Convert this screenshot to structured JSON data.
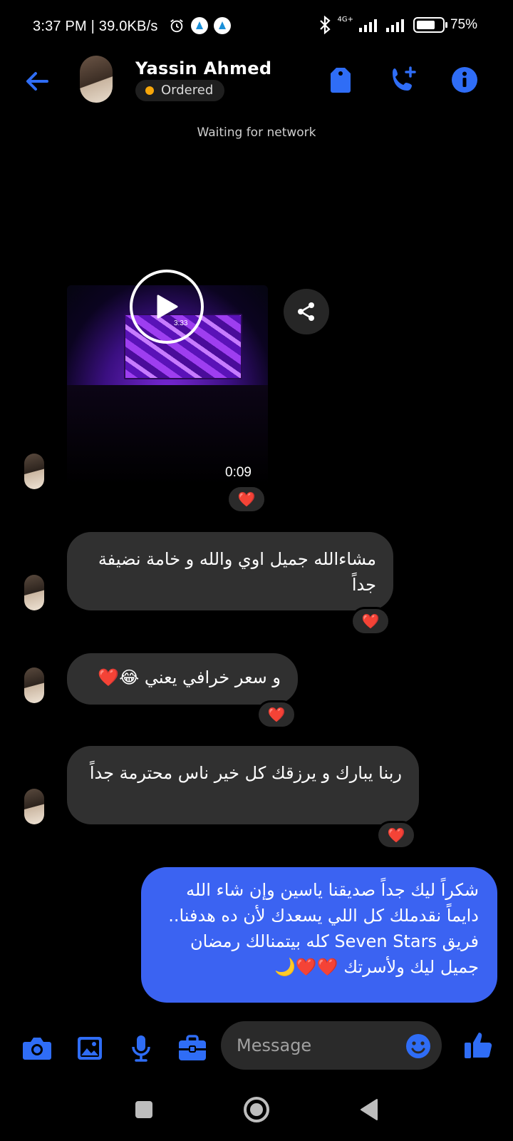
{
  "status_bar": {
    "time_speed": "3:37 PM | 39.0KB/s",
    "network_type": "4G+",
    "battery_percent": "75%",
    "battery_level": 0.75
  },
  "header": {
    "contact_name": "Yassin Ahmed",
    "status_label": "Ordered",
    "status_color": "#f6a60a",
    "icons": [
      "back-arrow-icon",
      "tag-icon",
      "add-call-icon",
      "info-icon"
    ]
  },
  "network_notice": "Waiting for network",
  "video": {
    "duration": "0:09",
    "screen_clock": "3:33"
  },
  "messages": [
    {
      "id": "m1",
      "direction": "in",
      "text": "مشاءالله جميل اوي والله و خامة نضيفة جداً",
      "reaction": "❤️"
    },
    {
      "id": "m2",
      "direction": "in",
      "text": "و سعر خرافي يعني 😂❤️",
      "reaction": "❤️"
    },
    {
      "id": "m3",
      "direction": "in",
      "text": "ربنا يبارك و يرزقك كل خير ناس محترمة جداً",
      "reaction": "❤️"
    },
    {
      "id": "m4",
      "direction": "out",
      "text": "شكراً ليك جداً صديقنا ياسين وإن شاء الله دايماً نقدملك كل اللي يسعدك لأن ده هدفنا.. فريق Seven Stars كله بيتمنالك رمضان جميل ليك ولأسرتك ❤️❤️🌙"
    }
  ],
  "video_reaction": "❤️",
  "composer": {
    "placeholder": "Message",
    "tools": [
      "camera-icon",
      "gallery-icon",
      "microphone-icon",
      "briefcase-icon"
    ]
  },
  "colors": {
    "accent": "#3b63f2",
    "icon_blue": "#1877f2",
    "incoming_bubble": "#303030",
    "heart": "#ff3040"
  }
}
